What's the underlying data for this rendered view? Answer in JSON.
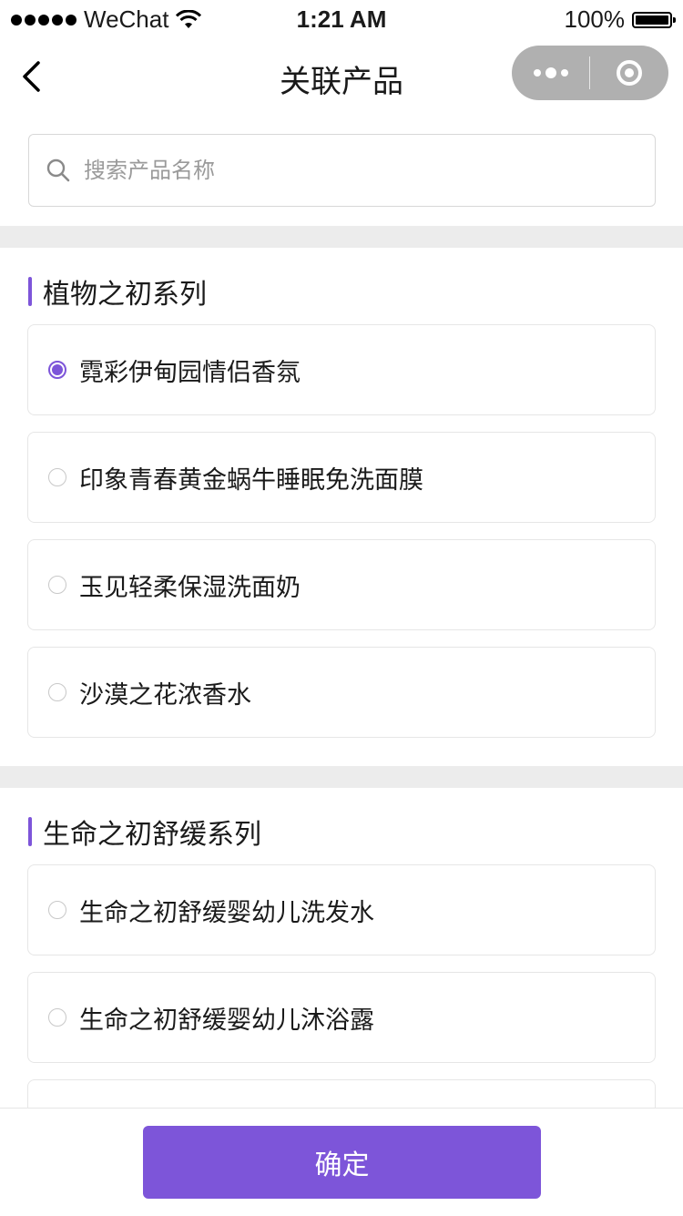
{
  "status_bar": {
    "carrier": "WeChat",
    "time": "1:21 AM",
    "battery": "100%",
    "battery_level": 1.0
  },
  "nav": {
    "title": "关联产品",
    "back_icon": "chevron-left-icon",
    "more_icon": "more-dots-icon",
    "close_icon": "target-circle-icon"
  },
  "search": {
    "placeholder": "搜索产品名称",
    "value": ""
  },
  "sections": [
    {
      "title": "植物之初系列",
      "items": [
        {
          "label": "霓彩伊甸园情侣香氛",
          "selected": true
        },
        {
          "label": "印象青春黄金蜗牛睡眠免洗面膜",
          "selected": false
        },
        {
          "label": "玉见轻柔保湿洗面奶",
          "selected": false
        },
        {
          "label": "沙漠之花浓香水",
          "selected": false
        }
      ]
    },
    {
      "title": "生命之初舒缓系列",
      "items": [
        {
          "label": "生命之初舒缓婴幼儿洗发水",
          "selected": false
        },
        {
          "label": "生命之初舒缓婴幼儿沐浴露",
          "selected": false
        },
        {
          "label": "",
          "selected": false
        }
      ]
    }
  ],
  "footer": {
    "confirm_label": "确定"
  },
  "colors": {
    "accent": "#7d55d9",
    "divider": "#ececec",
    "capsule": "#b0b0b0"
  }
}
